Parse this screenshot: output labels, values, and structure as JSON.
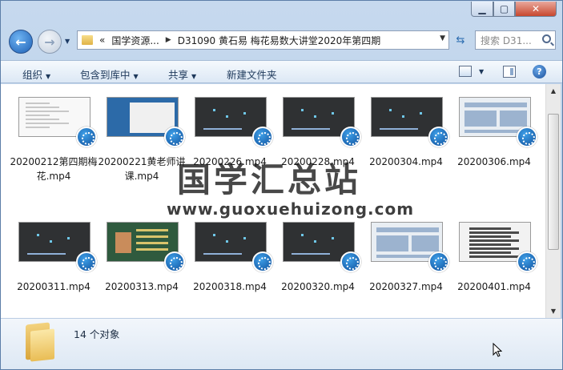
{
  "window": {
    "minimize_icon": "minimize-icon",
    "maximize_icon": "maximize-icon",
    "close_icon": "close-icon",
    "min_glyph": "▁",
    "max_glyph": "▢",
    "close_glyph": "✕"
  },
  "navigation": {
    "back_glyph": "←",
    "forward_glyph": "→",
    "recent_glyph": "▼",
    "address": {
      "chevron": "«",
      "crumb1": "国学资源...",
      "sep": "▶",
      "crumb2": "D31090 黄石易 梅花易数大讲堂2020年第四期",
      "dropdown_glyph": "▼"
    },
    "refresh_glyph": "⇆",
    "search_placeholder": "搜索 D31..."
  },
  "toolbar": {
    "organize": "组织",
    "include_in_library": "包含到库中",
    "share": "共享",
    "new_folder": "新建文件夹",
    "arrow": "▼",
    "help_glyph": "?"
  },
  "files": [
    {
      "name": "20200212第四期梅花.mp4",
      "thumb": "white"
    },
    {
      "name": "20200221黄老师讲课.mp4",
      "thumb": "blue"
    },
    {
      "name": "20200226.mp4",
      "thumb": "dark"
    },
    {
      "name": "20200228.mp4",
      "thumb": "dark"
    },
    {
      "name": "20200304.mp4",
      "thumb": "dark"
    },
    {
      "name": "20200306.mp4",
      "thumb": "light"
    },
    {
      "name": "20200311.mp4",
      "thumb": "dark"
    },
    {
      "name": "20200313.mp4",
      "thumb": "green"
    },
    {
      "name": "20200318.mp4",
      "thumb": "dark"
    },
    {
      "name": "20200320.mp4",
      "thumb": "dark"
    },
    {
      "name": "20200327.mp4",
      "thumb": "light"
    },
    {
      "name": "20200401.mp4",
      "thumb": "list"
    }
  ],
  "watermark": {
    "title": "国学汇总站",
    "url": "www.guoxuehuizong.com"
  },
  "scrollbar": {
    "up_glyph": "▲",
    "down_glyph": "▼"
  },
  "details": {
    "count": "14 个对象"
  },
  "colors": {
    "accent": "#1d5fb5",
    "window_frame": "#b4cbe6",
    "close": "#c8472e"
  }
}
